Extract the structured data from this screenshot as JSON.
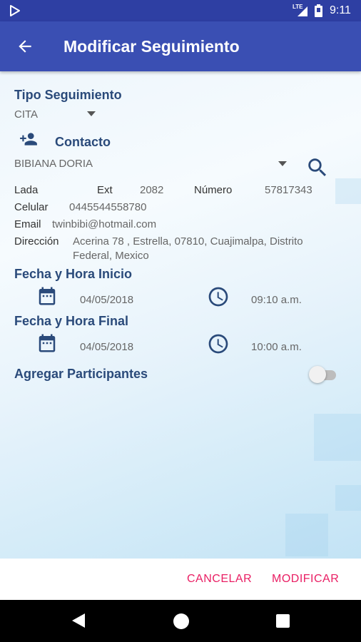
{
  "status_bar": {
    "network": "LTE",
    "time": "9:11"
  },
  "header": {
    "title": "Modificar Seguimiento"
  },
  "form": {
    "tipo_label": "Tipo Seguimiento",
    "tipo_value": "CITA",
    "contacto_label": "Contacto",
    "contacto_value": "BIBIANA DORIA",
    "lada_label": "Lada",
    "ext_label": "Ext",
    "ext_value": "2082",
    "numero_label": "Número",
    "numero_value": "57817343",
    "celular_label": "Celular",
    "celular_value": "0445544558780",
    "email_label": "Email",
    "email_value": "twinbibi@hotmail.com",
    "direccion_label": "Dirección",
    "direccion_line1": "Acerina 78 , Estrella, 07810, Cuajimalpa, Distrito",
    "direccion_line2": "Federal, Mexico",
    "inicio_label": "Fecha y Hora Inicio",
    "inicio_date": "04/05/2018",
    "inicio_time": "09:10 a.m.",
    "final_label": "Fecha y Hora Final",
    "final_date": "04/05/2018",
    "final_time": "10:00 a.m.",
    "participantes_label": "Agregar Participantes",
    "participantes_enabled": false
  },
  "actions": {
    "cancel": "CANCELAR",
    "modify": "MODIFICAR"
  },
  "colors": {
    "primary": "#3a4fb3",
    "status": "#2e3fa3",
    "accent": "#e91e63",
    "label": "#2a4a7a"
  },
  "icons": [
    "play-store-icon",
    "signal-icon",
    "battery-icon",
    "back-arrow-icon",
    "dropdown-arrow-icon",
    "add-contact-icon",
    "search-icon",
    "calendar-icon",
    "clock-icon",
    "nav-back-icon",
    "nav-home-icon",
    "nav-recent-icon"
  ]
}
